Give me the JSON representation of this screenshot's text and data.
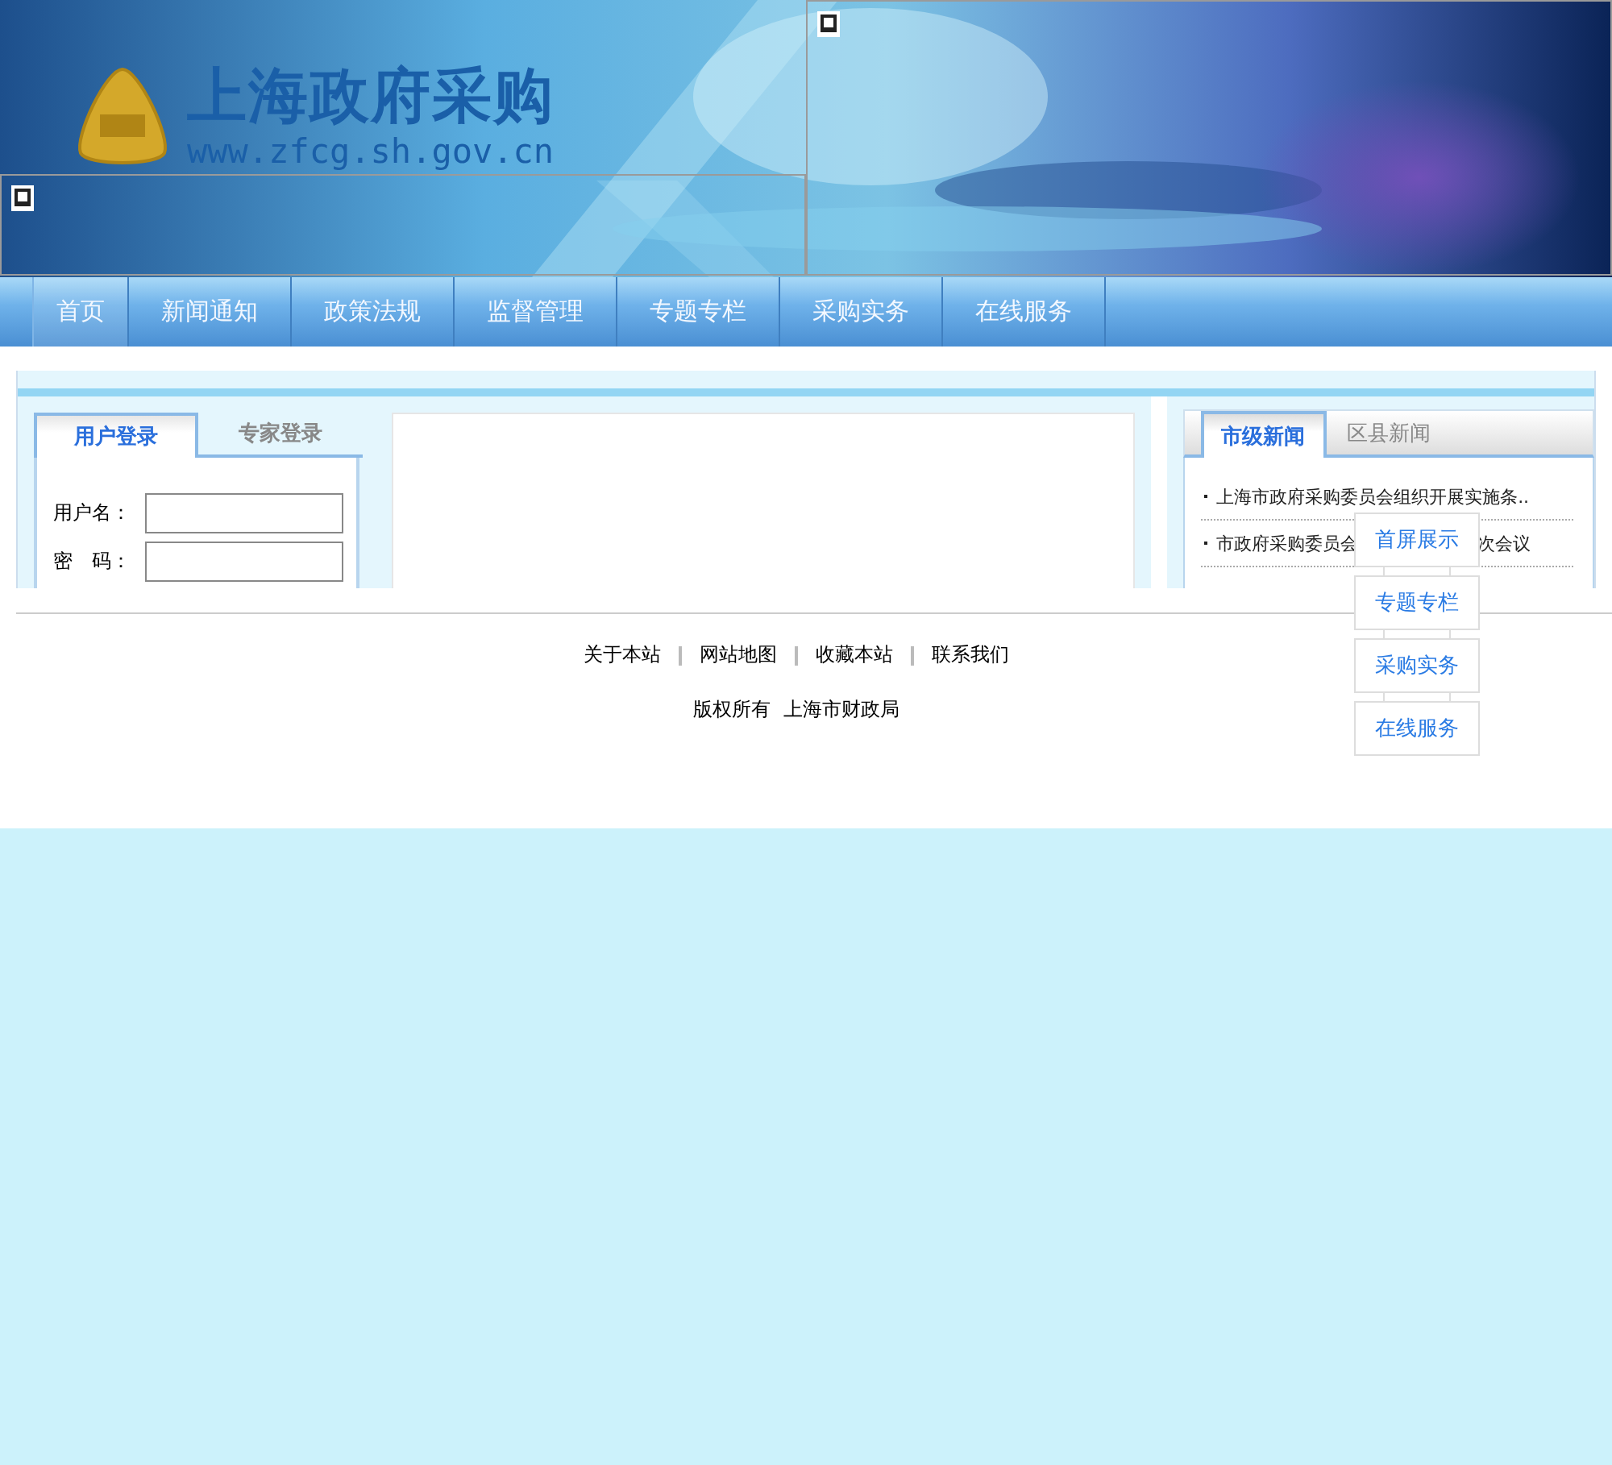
{
  "header": {
    "logo_title": "上海政府采购",
    "logo_url": "www.zfcg.sh.gov.cn"
  },
  "nav": [
    {
      "label": "首页",
      "selected": true
    },
    {
      "label": "新闻通知",
      "selected": false
    },
    {
      "label": "政策法规",
      "selected": false
    },
    {
      "label": "监督管理",
      "selected": false
    },
    {
      "label": "专题专栏",
      "selected": false
    },
    {
      "label": "采购实务",
      "selected": false
    },
    {
      "label": "在线服务",
      "selected": false
    }
  ],
  "login": {
    "tabs": [
      {
        "label": "用户登录",
        "selected": true
      },
      {
        "label": "专家登录",
        "selected": false
      }
    ],
    "fields": [
      {
        "label": "用户名："
      },
      {
        "label": "密　码："
      }
    ]
  },
  "news": {
    "tabs": [
      {
        "label": "市级新闻",
        "selected": true
      },
      {
        "label": "区县新闻",
        "selected": false
      }
    ],
    "items": [
      {
        "text": "上海市政府采购委员会组织开展实施条.."
      },
      {
        "text": "市政府采购委员会",
        "tail": "次会议"
      }
    ]
  },
  "float_menu": [
    "首屏展示",
    "专题专栏",
    "采购实务",
    "在线服务"
  ],
  "footer": {
    "links": [
      "关于本站",
      "网站地图",
      "收藏本站",
      "联系我们"
    ],
    "copyright": "版权所有  上海市财政局"
  }
}
